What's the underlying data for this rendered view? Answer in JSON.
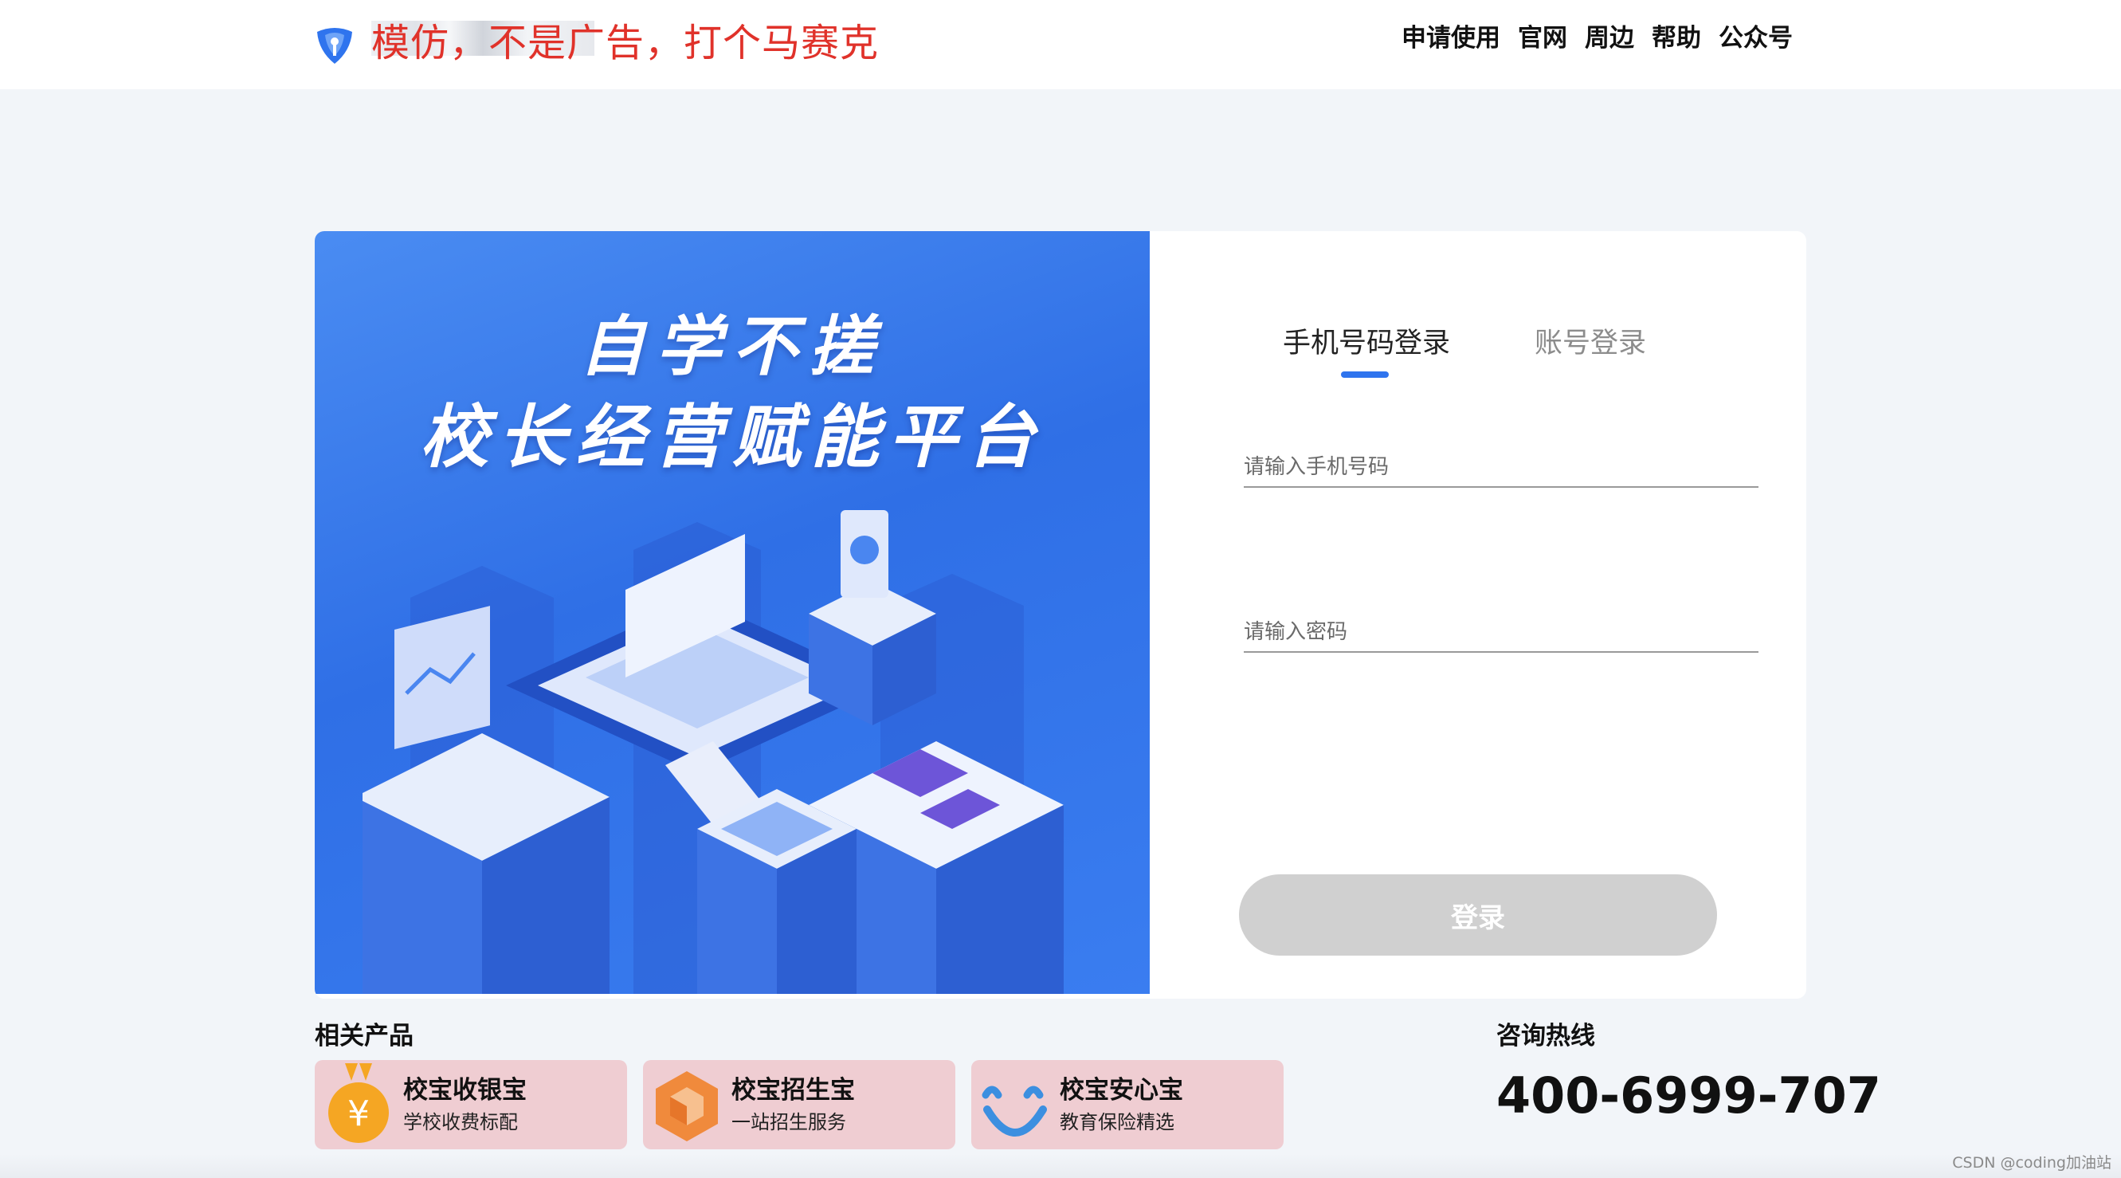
{
  "header": {
    "note": "模仿，不是广告，打个马赛克",
    "nav": [
      "申请使用",
      "官网",
      "周边",
      "帮助",
      "公众号"
    ]
  },
  "banner": {
    "line1": "自学不搓",
    "line2": "校长经营赋能平台"
  },
  "login": {
    "tabs": [
      "手机号码登录",
      "账号登录"
    ],
    "active_tab": 0,
    "phone_placeholder": "请输入手机号码",
    "password_placeholder": "请输入密码",
    "submit_label": "登录"
  },
  "products": {
    "title": "相关产品",
    "items": [
      {
        "name": "校宝收银宝",
        "desc": "学校收费标配",
        "icon": "yuan-medal-icon"
      },
      {
        "name": "校宝招生宝",
        "desc": "一站招生服务",
        "icon": "orange-hexagon-icon"
      },
      {
        "name": "校宝安心宝",
        "desc": "教育保险精选",
        "icon": "smile-icon"
      }
    ]
  },
  "hotline": {
    "title": "咨询热线",
    "number": "400-6999-707"
  },
  "credit": "CSDN @coding加油站",
  "colors": {
    "accent": "#2f74ee",
    "banner": "#3a7df0",
    "product_card": "#efcdd2",
    "button_disabled": "#d0d0d0",
    "note": "#e0322a"
  }
}
